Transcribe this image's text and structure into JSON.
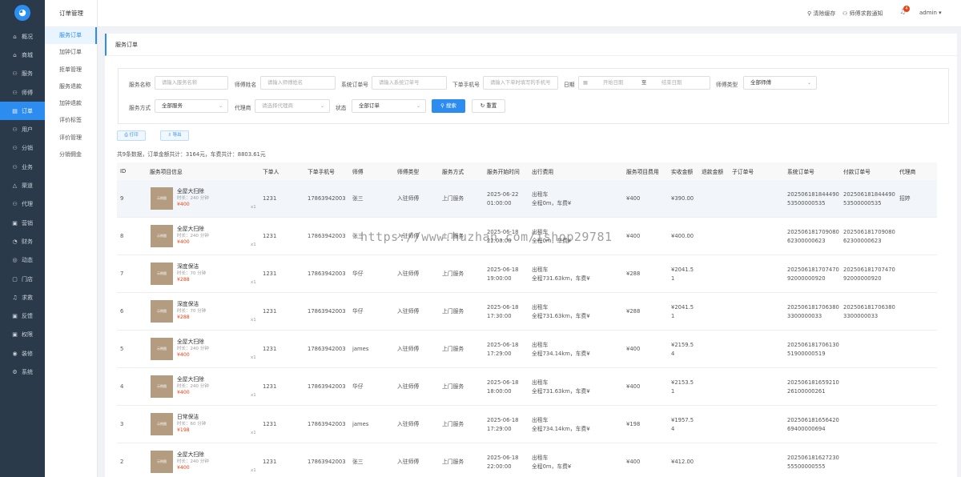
{
  "nav": {
    "items": [
      {
        "icon": "⌂",
        "label": "概况"
      },
      {
        "icon": "⌂",
        "label": "商城"
      },
      {
        "icon": "⚇",
        "label": "服务"
      },
      {
        "icon": "⚇",
        "label": "师傅"
      },
      {
        "icon": "▤",
        "label": "订单",
        "active": true
      },
      {
        "icon": "⚇",
        "label": "用户"
      },
      {
        "icon": "⚇",
        "label": "分销"
      },
      {
        "icon": "⚇",
        "label": "业务"
      },
      {
        "icon": "△",
        "label": "渠道"
      },
      {
        "icon": "⚇",
        "label": "代理"
      },
      {
        "icon": "▣",
        "label": "营销"
      },
      {
        "icon": "◔",
        "label": "财务"
      },
      {
        "icon": "◎",
        "label": "动态"
      },
      {
        "icon": "▢",
        "label": "门店"
      },
      {
        "icon": "♫",
        "label": "求救"
      },
      {
        "icon": "▣",
        "label": "反馈"
      },
      {
        "icon": "▣",
        "label": "权限"
      },
      {
        "icon": "◉",
        "label": "装修"
      },
      {
        "icon": "⚙",
        "label": "系统"
      }
    ]
  },
  "sub_menu": {
    "title": "订单管理",
    "items": [
      "服务订单",
      "加钟订单",
      "拒单管理",
      "服务退款",
      "加钟退款",
      "评价标签",
      "评价管理",
      "分销佣金"
    ]
  },
  "header": {
    "clear_cache": "清除缓存",
    "rescue_notice": "师傅求救通知",
    "badge": "4",
    "user": "admin"
  },
  "page": {
    "title": "服务订单",
    "summary": "共9条数据，订单金额共计：3164元，车费共计：8803.61元"
  },
  "filters": {
    "service_name_label": "服务名称",
    "service_name_ph": "请输入服务名称",
    "tech_name_label": "师傅姓名",
    "tech_name_ph": "请输入师傅姓名",
    "sys_order_label": "系统订单号",
    "sys_order_ph": "请输入系统订单号",
    "phone_label": "下单手机号",
    "phone_ph": "请输入下单时填写的手机号",
    "date_label": "日期",
    "date_start": "开始日期",
    "date_to": "至",
    "date_end": "结束日期",
    "tech_type_label": "师傅类型",
    "tech_type_value": "全部师傅",
    "service_mode_label": "服务方式",
    "service_mode_value": "全部服务",
    "agent_label": "代理商",
    "agent_ph": "请选择代理商",
    "status_label": "状态",
    "status_value": "全部订单",
    "search_btn": "搜索",
    "reset_btn": "重置",
    "print_btn": "打印",
    "export_btn": "导出"
  },
  "table": {
    "headers": [
      "ID",
      "服务项目信息",
      "下单人",
      "下单手机号",
      "师傅",
      "师傅类型",
      "服务方式",
      "服务开始时间",
      "出行费用",
      "服务项目费用",
      "实收金额",
      "退款金额",
      "子订单号",
      "系统订单号",
      "付款订单号",
      "代理商"
    ],
    "rows": [
      {
        "id": "9",
        "thumb": "示例图",
        "name": "全屋大扫除",
        "dur": "时长：240 分钟",
        "price": "¥400",
        "qty": "x1",
        "buyer": "1231",
        "phone": "17863942003",
        "tech": "张三",
        "tech_type": "入驻师傅",
        "mode": "上门服务",
        "time1": "2025-06-22",
        "time2": "01:00:00",
        "trip1": "出租车",
        "trip2": "全程0m，车费¥",
        "svc_fee": "¥400",
        "paid1": "¥390.00",
        "paid2": "",
        "sys1": "202506181844490",
        "sys2": "53500000535",
        "pay1": "202506181844490",
        "pay2": "53500000535",
        "agent": "招婷"
      },
      {
        "id": "8",
        "thumb": "示例图",
        "name": "全屋大扫除",
        "dur": "时长：240 分钟",
        "price": "¥400",
        "qty": "x1",
        "buyer": "1231",
        "phone": "17863942003",
        "tech": "张三",
        "tech_type": "入驻师傅",
        "mode": "上门服务",
        "time1": "2025-06-18",
        "time2": "22:00:00",
        "trip1": "出租车",
        "trip2": "全程0m，车费¥",
        "svc_fee": "¥400",
        "paid1": "¥400.00",
        "paid2": "",
        "sys1": "202506181709080",
        "sys2": "62300000623",
        "pay1": "202506181709080",
        "pay2": "62300000623",
        "agent": ""
      },
      {
        "id": "7",
        "thumb": "示例图",
        "name": "深度保洁",
        "dur": "时长：70 分钟",
        "price": "¥288",
        "qty": "x1",
        "buyer": "1231",
        "phone": "17863942003",
        "tech": "华仔",
        "tech_type": "入驻师傅",
        "mode": "上门服务",
        "time1": "2025-06-18",
        "time2": "19:00:00",
        "trip1": "出租车",
        "trip2": "全程731.63km，车费¥",
        "svc_fee": "¥288",
        "paid1": "¥2041.5",
        "paid2": "1",
        "sys1": "202506181707470",
        "sys2": "92000000920",
        "pay1": "202506181707470",
        "pay2": "92000000920",
        "agent": ""
      },
      {
        "id": "6",
        "thumb": "示例图",
        "name": "深度保洁",
        "dur": "时长：70 分钟",
        "price": "¥288",
        "qty": "x1",
        "buyer": "1231",
        "phone": "17863942003",
        "tech": "华仔",
        "tech_type": "入驻师傅",
        "mode": "上门服务",
        "time1": "2025-06-18",
        "time2": "17:30:00",
        "trip1": "出租车",
        "trip2": "全程731.63km，车费¥",
        "svc_fee": "¥288",
        "paid1": "¥2041.5",
        "paid2": "1",
        "sys1": "202506181706380",
        "sys2": "3300000033",
        "pay1": "202506181706380",
        "pay2": "3300000033",
        "agent": ""
      },
      {
        "id": "5",
        "thumb": "示例图",
        "name": "全屋大扫除",
        "dur": "时长：240 分钟",
        "price": "¥400",
        "qty": "x1",
        "buyer": "1231",
        "phone": "17863942003",
        "tech": "james",
        "tech_type": "入驻师傅",
        "mode": "上门服务",
        "time1": "2025-06-18",
        "time2": "17:29:00",
        "trip1": "出租车",
        "trip2": "全程734.14km，车费¥",
        "svc_fee": "¥400",
        "paid1": "¥2159.5",
        "paid2": "4",
        "sys1": "202506181706130",
        "sys2": "51900000519",
        "pay1": "",
        "pay2": "",
        "agent": ""
      },
      {
        "id": "4",
        "thumb": "示例图",
        "name": "全屋大扫除",
        "dur": "时长：240 分钟",
        "price": "¥400",
        "qty": "x1",
        "buyer": "1231",
        "phone": "17863942003",
        "tech": "华仔",
        "tech_type": "入驻师傅",
        "mode": "上门服务",
        "time1": "2025-06-18",
        "time2": "18:00:00",
        "trip1": "出租车",
        "trip2": "全程731.63km，车费¥",
        "svc_fee": "¥400",
        "paid1": "¥2153.5",
        "paid2": "1",
        "sys1": "202506181659210",
        "sys2": "26100000261",
        "pay1": "",
        "pay2": "",
        "agent": ""
      },
      {
        "id": "3",
        "thumb": "示例图",
        "name": "日常保洁",
        "dur": "时长：60 分钟",
        "price": "¥198",
        "qty": "x1",
        "buyer": "1231",
        "phone": "17863942003",
        "tech": "james",
        "tech_type": "入驻师傅",
        "mode": "上门服务",
        "time1": "2025-06-18",
        "time2": "17:29:00",
        "trip1": "出租车",
        "trip2": "全程734.14km，车费¥",
        "svc_fee": "¥198",
        "paid1": "¥1957.5",
        "paid2": "4",
        "sys1": "202506181656420",
        "sys2": "69400000694",
        "pay1": "",
        "pay2": "",
        "agent": ""
      },
      {
        "id": "2",
        "thumb": "示例图",
        "name": "全屋大扫除",
        "dur": "时长：240 分钟",
        "price": "¥400",
        "qty": "x1",
        "buyer": "1231",
        "phone": "17863942003",
        "tech": "张三",
        "tech_type": "入驻师傅",
        "mode": "上门服务",
        "time1": "2025-06-18",
        "time2": "22:00:00",
        "trip1": "出租车",
        "trip2": "全程0m，车费¥",
        "svc_fee": "¥400",
        "paid1": "¥412.00",
        "paid2": "",
        "sys1": "202506181627230",
        "sys2": "55500000555",
        "pay1": "",
        "pay2": "",
        "agent": ""
      }
    ]
  },
  "watermark": "https://www.huzhan.com/ishop29781"
}
